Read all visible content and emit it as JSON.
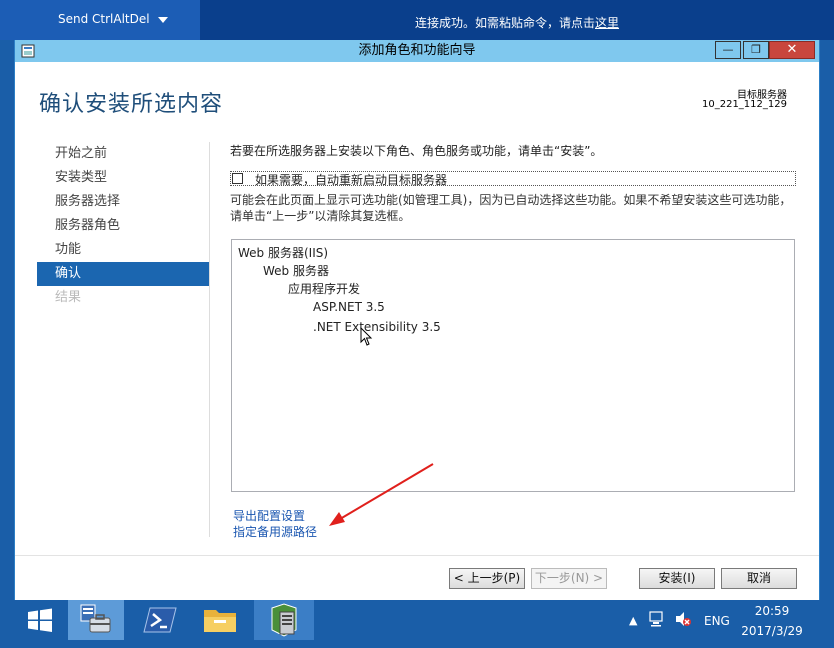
{
  "remote_bar": {
    "send_button_label": "Send CtrlAltDel",
    "message": "连接成功。如需粘贴命令，请点击",
    "message_link": "这里"
  },
  "window": {
    "title": "添加角色和功能向导",
    "min_label": "—",
    "max_label": "❐",
    "close_label": "✕"
  },
  "header": {
    "page_title": "确认安装所选内容",
    "dest_label": "目标服务器",
    "dest_value": "10_221_112_129"
  },
  "nav": {
    "items": [
      {
        "label": "开始之前",
        "state": "normal"
      },
      {
        "label": "安装类型",
        "state": "normal"
      },
      {
        "label": "服务器选择",
        "state": "normal"
      },
      {
        "label": "服务器角色",
        "state": "normal"
      },
      {
        "label": "功能",
        "state": "normal"
      },
      {
        "label": "确认",
        "state": "active"
      },
      {
        "label": "结果",
        "state": "disabled"
      }
    ]
  },
  "content": {
    "instruction": "若要在所选服务器上安装以下角色、角色服务或功能，请单击“安装”。",
    "restart_label": "如果需要，自动重新启动目标服务器",
    "restart_checked": false,
    "note": "可能会在此页面上显示可选功能(如管理工具)，因为已自动选择这些功能。如果不希望安装这些可选功能，请单击“上一步”以清除其复选框。",
    "features": [
      {
        "label": "Web 服务器(IIS)",
        "level": 0
      },
      {
        "label": "Web 服务器",
        "level": 1
      },
      {
        "label": "应用程序开发",
        "level": 2
      },
      {
        "label": "ASP.NET 3.5",
        "level": 3
      },
      {
        "label": ".NET Extensibility 3.5",
        "level": 3
      }
    ],
    "export_link": "导出配置设置",
    "source_link": "指定备用源路径"
  },
  "buttons": {
    "prev": "< 上一步(P)",
    "next": "下一步(N) >",
    "install": "安装(I)",
    "cancel": "取消"
  },
  "taskbar": {
    "language": "ENG",
    "time": "20:59",
    "date": "2017/3/29"
  },
  "colors": {
    "accent": "#1b66b0",
    "titlebar": "#7fc8ee",
    "close": "#c9463d",
    "arrow": "#e0201c",
    "taskbar": "#1a5ea8"
  },
  "icons": {
    "start": "windows-logo-icon",
    "server_manager": "server-manager-icon",
    "powershell": "powershell-icon",
    "explorer": "folder-icon",
    "wizard": "add-roles-wizard-icon",
    "network": "network-icon",
    "sound": "sound-muted-icon"
  }
}
